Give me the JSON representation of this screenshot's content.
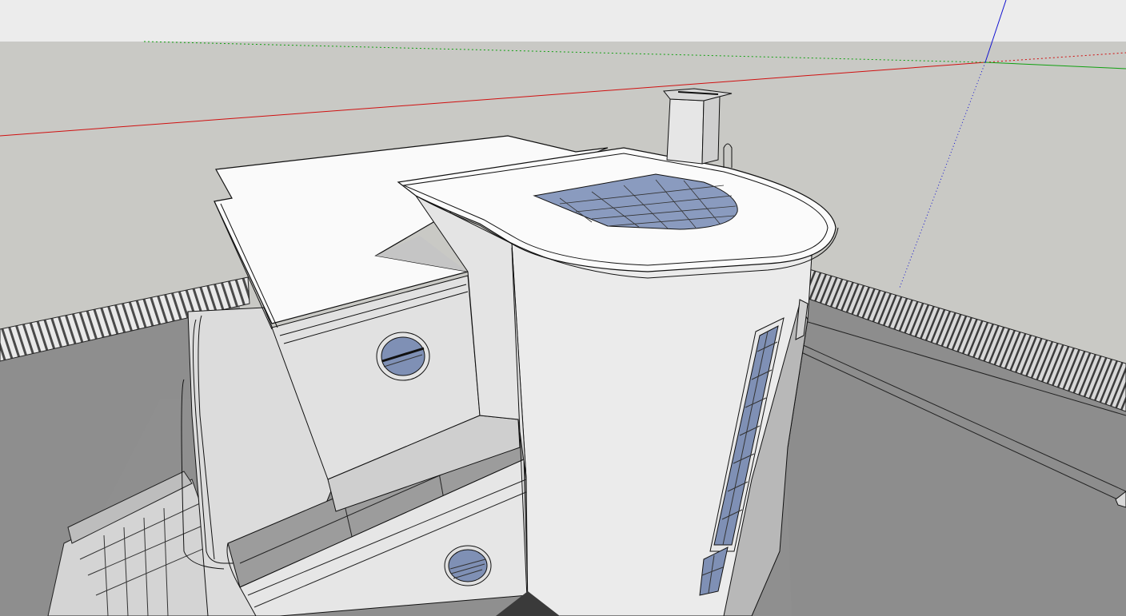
{
  "app": {
    "view": "3D model viewport",
    "style": "shaded with edges"
  },
  "colors": {
    "sky": "#ececec",
    "ground": "#c9c9c5",
    "site": "#8f8f8f",
    "wall_light": "#eeeeee",
    "wall_mid": "#d6d6d6",
    "wall_shade": "#b9b9b9",
    "roof": "#fafafa",
    "glass": "#8a9bbf",
    "edge": "#000000",
    "axis_red": "#d01010",
    "axis_green": "#10a010",
    "axis_blue": "#1010d0"
  },
  "axes": {
    "red": "red-axis",
    "green": "green-axis",
    "blue": "blue-axis"
  },
  "model": {
    "name": "house-model",
    "parts": [
      "flat-roof",
      "rounded-roof-terrace",
      "chimney",
      "skylight",
      "porthole-window-upper",
      "porthole-window-lower",
      "strip-window",
      "fence",
      "stairs",
      "balcony-band"
    ]
  }
}
